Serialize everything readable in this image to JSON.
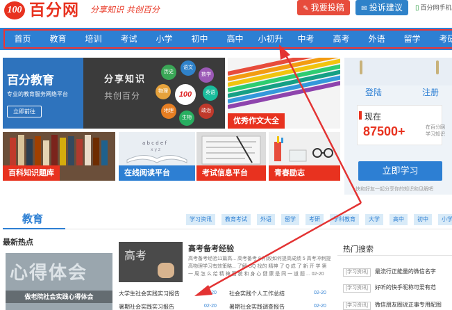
{
  "header": {
    "logo_badge": "100",
    "logo_text": "百分网",
    "slogan": "分享知识 共创百分",
    "submit_button": "我要投稿",
    "feedback_button": "投诉建议",
    "mobile_link": "百分网手机"
  },
  "nav": {
    "items": [
      "首页",
      "教育",
      "培训",
      "考试",
      "小学",
      "初中",
      "高中",
      "小初升",
      "中考",
      "高考",
      "外语",
      "留学",
      "考研"
    ]
  },
  "banner": {
    "title": "百分教育",
    "subtitle": "专业的教育服务网络平台",
    "button": "立即前往",
    "share_text": "分享知识",
    "share_text2": "共创百分",
    "badge": "100",
    "subjects": [
      "历史",
      "语文",
      "数学",
      "物理",
      "英语",
      "地理",
      "政治",
      "生物"
    ]
  },
  "tiles": {
    "composition": "优秀作文大全",
    "encyclopedia": "百科知识题库",
    "reading": "在线阅读平台",
    "exam_info": "考试信息平台",
    "youth": "青春励志"
  },
  "login": {
    "login_link": "登陆",
    "register_link": "注册",
    "now_label": "现在",
    "count": "87500+",
    "count_desc": "在百分网学习知识",
    "learn_button": "立即学习",
    "note": "快和好友一起分享你的知识和见解吧"
  },
  "education": {
    "title": "教育",
    "tags": [
      "学习资讯",
      "教育考试",
      "外语",
      "留学",
      "考研",
      "学科教育",
      "大学",
      "高中",
      "初中",
      "小学"
    ],
    "hot_title": "最新热点",
    "hot_image_text": "心得体会",
    "hot_caption": "做老院社会实践心得体会",
    "feature_board": "高考",
    "feature_title": "高考备考经验",
    "feature_desc": "高考备考经验11篇高... 高考备考 8 阶段如何提高成绩 5 高考冲刺提高物理学习有效策略... 了解 GQ 找的 精神 了 Q 成 了 新 开 学 第 一 周 怎 么 给 精 神 面 貌 和 身 心 健 康 是 同 一 道 题 ... 02-20",
    "articles": [
      {
        "title": "大学生社会实践实习报告",
        "date": "02-20"
      },
      {
        "title": "社会实践个人工作总结",
        "date": "02-20"
      },
      {
        "title": "暑期社会实践实习报告",
        "date": "02-20"
      },
      {
        "title": "暑期社会实践调查报告",
        "date": "02-20"
      }
    ]
  },
  "hot_search": {
    "title": "热门搜索",
    "items": [
      {
        "tag": "[学习资讯]",
        "text": "最流行正能量的微信名字"
      },
      {
        "tag": "[学习资讯]",
        "text": "好听的快手昵称可爱有范"
      },
      {
        "tag": "[学习资讯]",
        "text": "微信朋友圈说正事专用配图"
      }
    ]
  },
  "colors": {
    "brand_red": "#e8321f",
    "brand_blue": "#2d7fd3",
    "annotation_red": "#e33333"
  }
}
